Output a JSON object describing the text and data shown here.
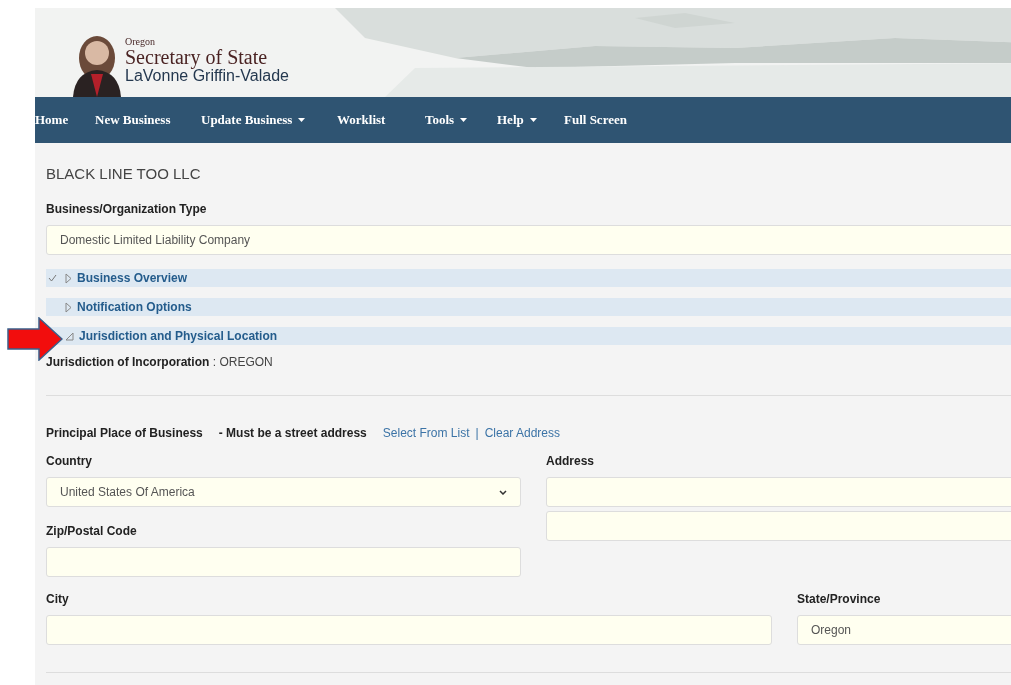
{
  "header": {
    "state_name": "Oregon",
    "office": "Secretary of State",
    "officer": "LaVonne Griffin-Valade"
  },
  "nav": [
    {
      "label": "Home",
      "dropdown": false
    },
    {
      "label": "New Business",
      "dropdown": false
    },
    {
      "label": "Update Business",
      "dropdown": true
    },
    {
      "label": "Worklist",
      "dropdown": false
    },
    {
      "label": "Tools",
      "dropdown": true
    },
    {
      "label": "Help",
      "dropdown": true
    },
    {
      "label": "Full Screen",
      "dropdown": false
    }
  ],
  "business_name": "BLACK LINE TOO LLC",
  "business_type": {
    "label": "Business/Organization Type",
    "value": "Domestic Limited Liability Company"
  },
  "sections": [
    {
      "label": "Business Overview",
      "checked": true,
      "expanded": false
    },
    {
      "label": "Notification Options",
      "checked": false,
      "expanded": false
    },
    {
      "label": "Jurisdiction and Physical Location",
      "checked": false,
      "expanded": true
    }
  ],
  "jurisdiction": {
    "label": "Jurisdiction of Incorporation",
    "separator": ":",
    "value": "OREGON"
  },
  "principal": {
    "label": "Principal Place of Business",
    "note": "- Must be a street address",
    "links": [
      "Select From List",
      "Clear Address"
    ],
    "separator": "|"
  },
  "country": {
    "label": "Country",
    "value": "United States Of America"
  },
  "address": {
    "label": "Address",
    "lines": [
      {
        "kind": "text"
      },
      {
        "kind": "text"
      }
    ]
  },
  "zip": {
    "label": "Zip/Postal Code"
  },
  "city": {
    "label": "City"
  },
  "state": {
    "label": "State/Province",
    "value": "Oregon"
  }
}
